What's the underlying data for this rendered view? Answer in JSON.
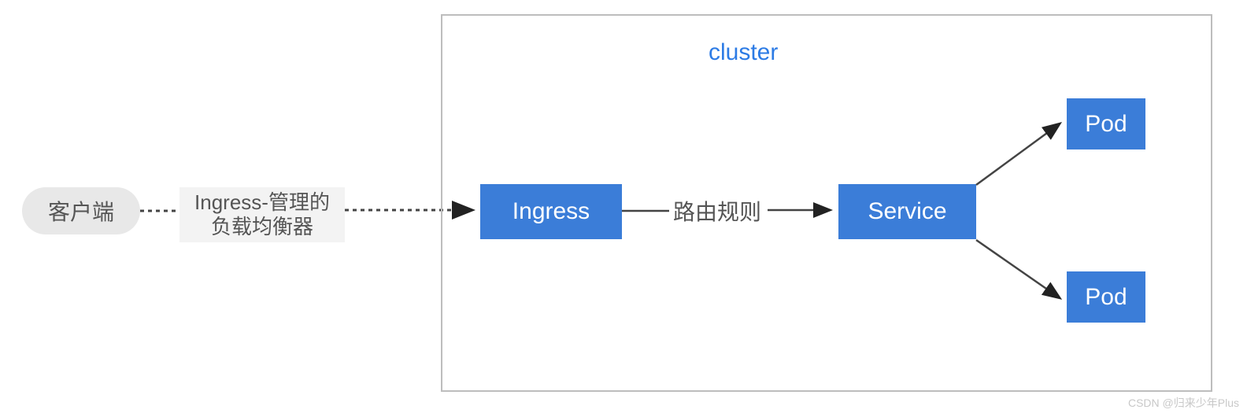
{
  "diagram": {
    "client": "客户端",
    "loadBalancer": "Ingress-管理的\n负载均衡器",
    "clusterLabel": "cluster",
    "ingress": "Ingress",
    "routeRule": "路由规则",
    "service": "Service",
    "pod1": "Pod",
    "pod2": "Pod",
    "watermark": "CSDN @归来少年Plus"
  },
  "colors": {
    "blueBox": "#3b7dd8",
    "clusterBorder": "#bdbdbd",
    "textGray": "#555555",
    "linkBlue": "#2c7be5"
  }
}
